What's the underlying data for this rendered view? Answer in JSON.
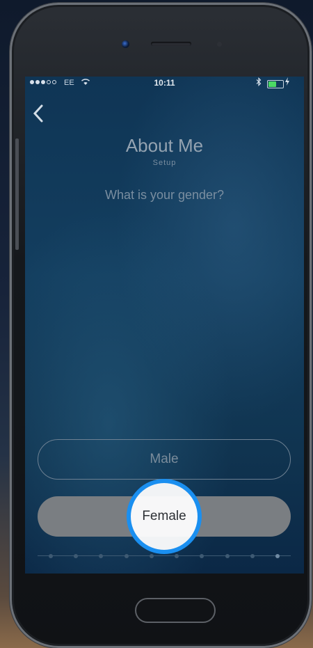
{
  "status_bar": {
    "carrier": "EE",
    "wifi_icon": "wifi-icon",
    "time": "10:11",
    "bluetooth_icon": "bluetooth-icon",
    "battery_level": 0.55,
    "charging_icon": "charging-icon"
  },
  "nav": {
    "back_icon": "chevron-left-icon"
  },
  "header": {
    "title": "About Me",
    "subtitle": "Setup"
  },
  "question": "What is your gender?",
  "options": [
    {
      "label": "Male",
      "selected": false
    },
    {
      "label": "Female",
      "selected": true
    }
  ],
  "progress": {
    "steps": 10,
    "current_step": 10
  },
  "colors": {
    "highlight_ring": "#1a8ff0",
    "selected_option_bg": "#7a7e82"
  }
}
